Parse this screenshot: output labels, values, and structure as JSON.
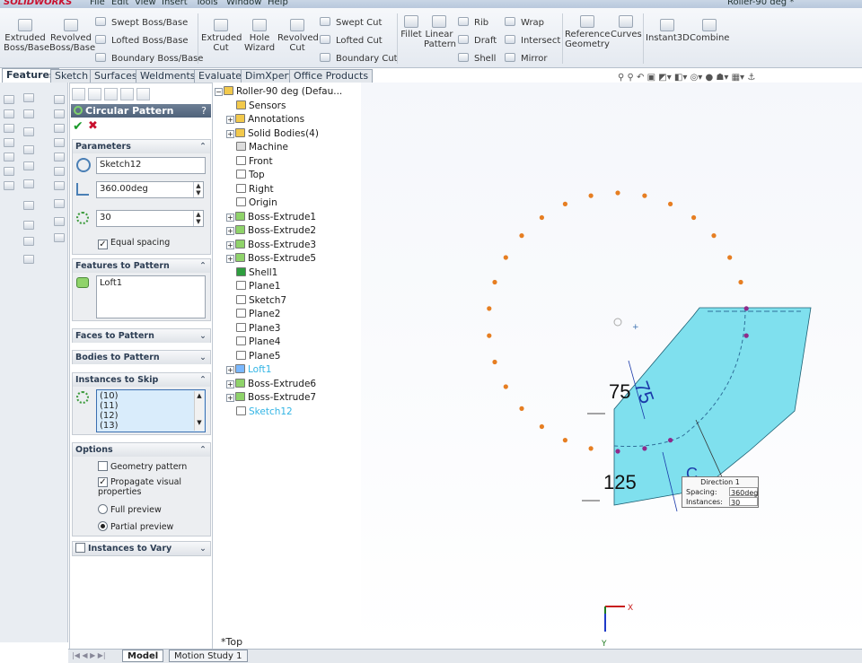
{
  "app": {
    "logo": "SOLIDWORKS",
    "menus": [
      "File",
      "Edit",
      "View",
      "Insert",
      "Tools",
      "Window",
      "Help"
    ],
    "doc_title": "Roller-90 deg *"
  },
  "ribbon": {
    "extruded_boss": "Extruded Boss/Base",
    "revolved_boss": "Revolved Boss/Base",
    "swept_boss": "Swept Boss/Base",
    "lofted_boss": "Lofted Boss/Base",
    "boundary_boss": "Boundary Boss/Base",
    "extruded_cut": "Extruded Cut",
    "hole_wizard": "Hole Wizard",
    "revolved_cut": "Revolved Cut",
    "swept_cut": "Swept Cut",
    "lofted_cut": "Lofted Cut",
    "boundary_cut": "Boundary Cut",
    "fillet": "Fillet",
    "linear_pattern": "Linear Pattern",
    "rib": "Rib",
    "draft": "Draft",
    "shell": "Shell",
    "wrap": "Wrap",
    "intersect": "Intersect",
    "mirror": "Mirror",
    "reference_geometry": "Reference Geometry",
    "curves": "Curves",
    "instant3d": "Instant3D",
    "combine": "Combine"
  },
  "tabs": [
    "Features",
    "Sketch",
    "Surfaces",
    "Weldments",
    "Evaluate",
    "DimXpert",
    "Office Products"
  ],
  "property_manager": {
    "title": "Circular Pattern",
    "help": "?",
    "parameters": {
      "header": "Parameters",
      "axis": "Sketch12",
      "angle": "360.00deg",
      "instances": "30",
      "equal_spacing": "Equal spacing"
    },
    "features": {
      "header": "Features to Pattern",
      "items": [
        "Loft1"
      ]
    },
    "faces": {
      "header": "Faces to Pattern"
    },
    "bodies": {
      "header": "Bodies to Pattern"
    },
    "skip": {
      "header": "Instances to Skip",
      "items": [
        "(10)",
        "(11)",
        "(12)",
        "(13)"
      ]
    },
    "options": {
      "header": "Options",
      "geometry_pattern": "Geometry pattern",
      "propagate": "Propagate visual properties",
      "full_preview": "Full preview",
      "partial_preview": "Partial preview"
    },
    "vary": {
      "header": "Instances to Vary"
    }
  },
  "tree": [
    {
      "label": "Roller-90 deg  (Defau...",
      "icon": "part-icon",
      "color": ""
    },
    {
      "label": "Sensors",
      "icon": "sensor-icon",
      "color": ""
    },
    {
      "label": "Annotations",
      "icon": "annotation-icon",
      "color": ""
    },
    {
      "label": "Solid Bodies(4)",
      "icon": "solid-bodies-icon",
      "color": ""
    },
    {
      "label": "Machine",
      "icon": "material-icon",
      "color": ""
    },
    {
      "label": "Front",
      "icon": "plane-icon",
      "color": ""
    },
    {
      "label": "Top",
      "icon": "plane-icon",
      "color": ""
    },
    {
      "label": "Right",
      "icon": "plane-icon",
      "color": ""
    },
    {
      "label": "Origin",
      "icon": "origin-icon",
      "color": ""
    },
    {
      "label": "Boss-Extrude1",
      "icon": "extrude-icon",
      "color": ""
    },
    {
      "label": "Boss-Extrude2",
      "icon": "extrude-icon",
      "color": ""
    },
    {
      "label": "Boss-Extrude3",
      "icon": "extrude-icon",
      "color": ""
    },
    {
      "label": "Boss-Extrude5",
      "icon": "extrude-icon",
      "color": ""
    },
    {
      "label": "Shell1",
      "icon": "shell-icon",
      "color": ""
    },
    {
      "label": "Plane1",
      "icon": "plane-icon",
      "color": ""
    },
    {
      "label": "Sketch7",
      "icon": "sketch-icon",
      "color": ""
    },
    {
      "label": "Plane2",
      "icon": "plane-icon",
      "color": ""
    },
    {
      "label": "Plane3",
      "icon": "plane-icon",
      "color": ""
    },
    {
      "label": "Plane4",
      "icon": "plane-icon",
      "color": ""
    },
    {
      "label": "Plane5",
      "icon": "plane-icon",
      "color": ""
    },
    {
      "label": "Loft1",
      "icon": "loft-icon",
      "color": "#33b5e5"
    },
    {
      "label": "Boss-Extrude6",
      "icon": "extrude-icon",
      "color": ""
    },
    {
      "label": "Boss-Extrude7",
      "icon": "extrude-icon",
      "color": ""
    },
    {
      "label": "Sketch12",
      "icon": "sketch-icon",
      "color": "#33b5e5"
    }
  ],
  "viewport": {
    "dim_75": "75",
    "dim_75b": "75",
    "dim_125": "125",
    "callout": {
      "title": "Direction 1",
      "spacing_label": "Spacing:",
      "spacing": "360deg",
      "instances_label": "Instances:",
      "instances": "30"
    },
    "view_label": "*Top",
    "triad_x": "X",
    "triad_y": "Y",
    "preview_color": "#e67e22",
    "body_color": "#7fe0ee"
  },
  "bottom_tabs": [
    "Model",
    "Motion Study 1"
  ]
}
